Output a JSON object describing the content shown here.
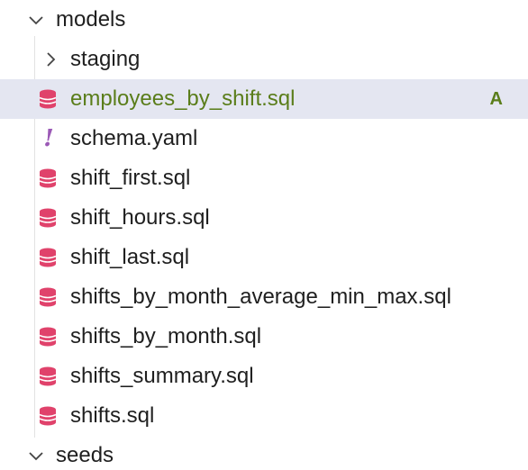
{
  "explorer": {
    "models_folder": {
      "label": "models",
      "expanded": true,
      "icon": "chevron-down-icon"
    },
    "staging_folder": {
      "label": "staging",
      "expanded": false,
      "icon": "chevron-right-icon"
    },
    "files": [
      {
        "label": "employees_by_shift.sql",
        "icon": "database-icon",
        "status": "A",
        "selected": true
      },
      {
        "label": "schema.yaml",
        "icon": "yaml-exclamation-icon"
      },
      {
        "label": "shift_first.sql",
        "icon": "database-icon"
      },
      {
        "label": "shift_hours.sql",
        "icon": "database-icon"
      },
      {
        "label": "shift_last.sql",
        "icon": "database-icon"
      },
      {
        "label": "shifts_by_month_average_min_max.sql",
        "icon": "database-icon"
      },
      {
        "label": "shifts_by_month.sql",
        "icon": "database-icon"
      },
      {
        "label": "shifts_summary.sql",
        "icon": "database-icon"
      },
      {
        "label": "shifts.sql",
        "icon": "database-icon"
      }
    ],
    "seeds_folder": {
      "label": "seeds",
      "expanded": true,
      "icon": "chevron-down-icon"
    }
  },
  "colors": {
    "sql_icon": "#e0426b",
    "yaml_icon": "#9b59b6",
    "added_file": "#5a7d1a",
    "selection_bg": "#e4e6f1",
    "text": "#1f1f1f"
  }
}
